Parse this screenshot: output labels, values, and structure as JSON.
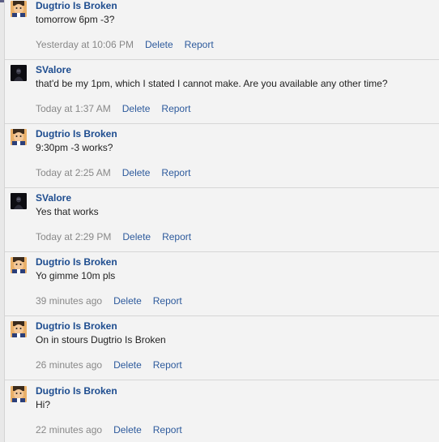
{
  "messages": [
    {
      "author": "Dugtrio Is Broken",
      "avatar": "cartoon-man-icon",
      "text": "tomorrow 6pm -3?",
      "time": "Yesterday at 10:06 PM",
      "delete": "Delete",
      "report": "Report"
    },
    {
      "author": "SValore",
      "avatar": "dark-figure-icon",
      "text": "that'd be my 1pm, which I stated I cannot make. Are you available any other time?",
      "time": "Today at 1:37 AM",
      "delete": "Delete",
      "report": "Report"
    },
    {
      "author": "Dugtrio Is Broken",
      "avatar": "cartoon-man-icon",
      "text": "9:30pm -3 works?",
      "time": "Today at 2:25 AM",
      "delete": "Delete",
      "report": "Report"
    },
    {
      "author": "SValore",
      "avatar": "dark-figure-icon",
      "text": "Yes that works",
      "time": "Today at 2:29 PM",
      "delete": "Delete",
      "report": "Report"
    },
    {
      "author": "Dugtrio Is Broken",
      "avatar": "cartoon-man-icon",
      "text": "Yo gimme 10m pls",
      "time": "39 minutes ago",
      "delete": "Delete",
      "report": "Report"
    },
    {
      "author": "Dugtrio Is Broken",
      "avatar": "cartoon-man-icon",
      "text": "On in stours Dugtrio Is Broken",
      "time": "26 minutes ago",
      "delete": "Delete",
      "report": "Report"
    },
    {
      "author": "Dugtrio Is Broken",
      "avatar": "cartoon-man-icon",
      "text": "Hi?",
      "time": "22 minutes ago",
      "delete": "Delete",
      "report": "Report"
    }
  ],
  "colors": {
    "author": "#1d4c8f",
    "action": "#2d5a9c",
    "meta": "#888888",
    "background": "#f3f3f3",
    "topbar": "#5c5f86"
  }
}
